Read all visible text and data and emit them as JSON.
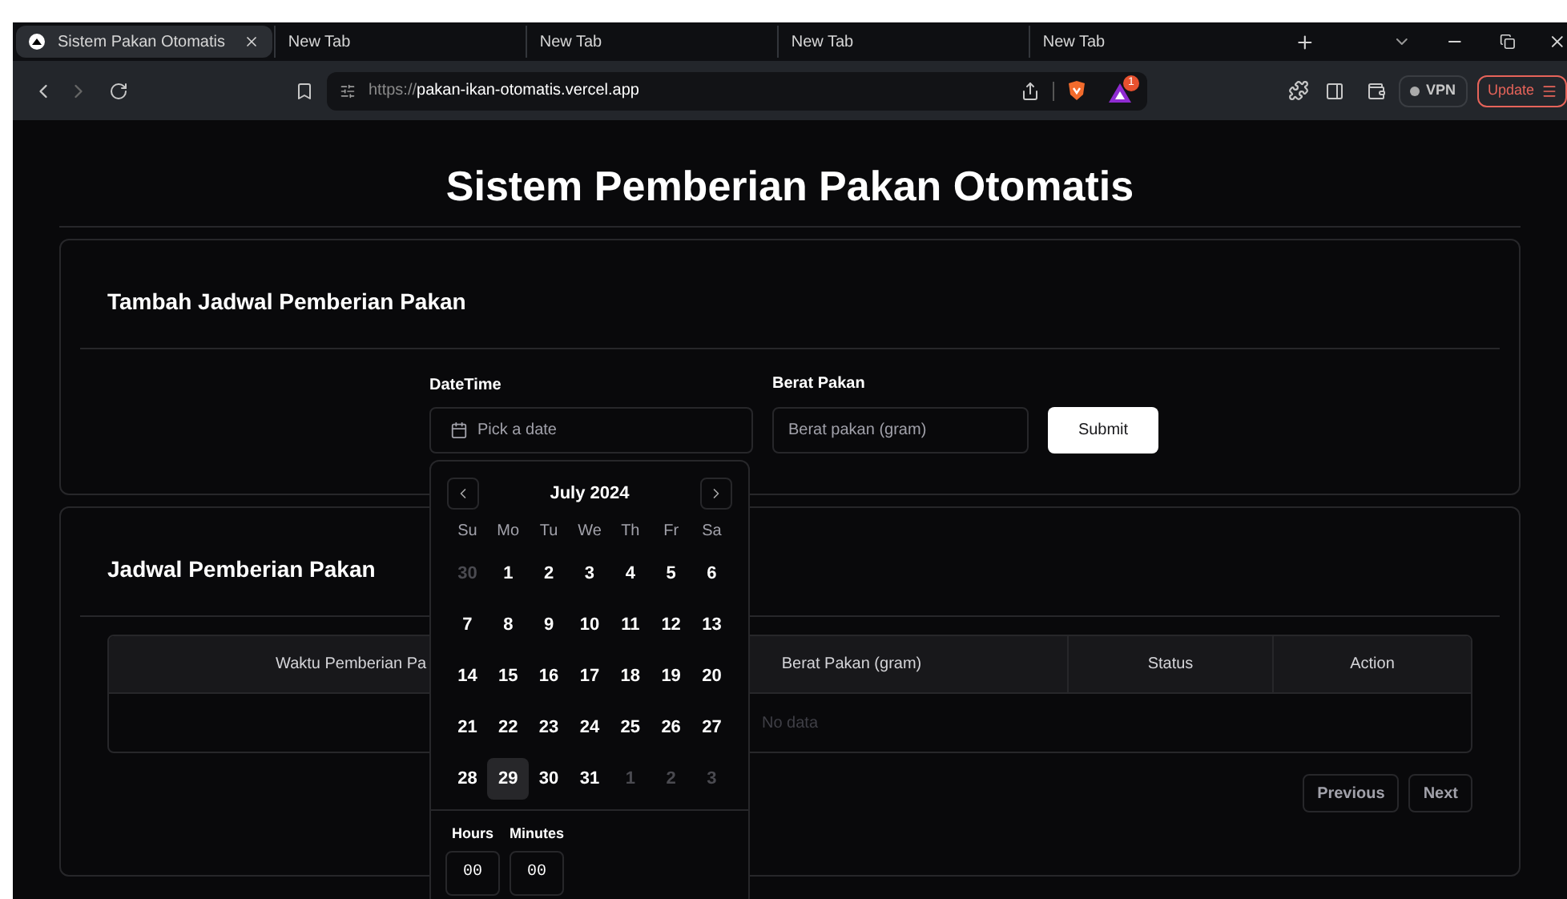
{
  "browser": {
    "tabs": [
      {
        "title": "Sistem Pakan Otomatis",
        "selected": true
      },
      {
        "title": "New Tab",
        "selected": false
      },
      {
        "title": "New Tab",
        "selected": false
      },
      {
        "title": "New Tab",
        "selected": false
      },
      {
        "title": "New Tab",
        "selected": false
      }
    ],
    "url_scheme": "https://",
    "url_host": "pakan-ikan-otomatis.vercel.app",
    "alert_badge": "1",
    "vpn": "VPN",
    "update": "Update"
  },
  "page_title": "Sistem Pemberian Pakan Otomatis",
  "form_card": {
    "title": "Tambah Jadwal Pemberian Pakan",
    "datetime_label": "DateTime",
    "datetime_placeholder": "Pick a date",
    "weight_label": "Berat Pakan",
    "weight_placeholder": "Berat pakan (gram)",
    "submit": "Submit"
  },
  "calendar": {
    "month": "July 2024",
    "weekdays": [
      "Su",
      "Mo",
      "Tu",
      "We",
      "Th",
      "Fr",
      "Sa"
    ],
    "weeks": [
      [
        {
          "label": "30",
          "outside": true,
          "selected": false
        },
        {
          "label": "1",
          "outside": false,
          "selected": false
        },
        {
          "label": "2",
          "outside": false,
          "selected": false
        },
        {
          "label": "3",
          "outside": false,
          "selected": false
        },
        {
          "label": "4",
          "outside": false,
          "selected": false
        },
        {
          "label": "5",
          "outside": false,
          "selected": false
        },
        {
          "label": "6",
          "outside": false,
          "selected": false
        }
      ],
      [
        {
          "label": "7",
          "outside": false,
          "selected": false
        },
        {
          "label": "8",
          "outside": false,
          "selected": false
        },
        {
          "label": "9",
          "outside": false,
          "selected": false
        },
        {
          "label": "10",
          "outside": false,
          "selected": false
        },
        {
          "label": "11",
          "outside": false,
          "selected": false
        },
        {
          "label": "12",
          "outside": false,
          "selected": false
        },
        {
          "label": "13",
          "outside": false,
          "selected": false
        }
      ],
      [
        {
          "label": "14",
          "outside": false,
          "selected": false
        },
        {
          "label": "15",
          "outside": false,
          "selected": false
        },
        {
          "label": "16",
          "outside": false,
          "selected": false
        },
        {
          "label": "17",
          "outside": false,
          "selected": false
        },
        {
          "label": "18",
          "outside": false,
          "selected": false
        },
        {
          "label": "19",
          "outside": false,
          "selected": false
        },
        {
          "label": "20",
          "outside": false,
          "selected": false
        }
      ],
      [
        {
          "label": "21",
          "outside": false,
          "selected": false
        },
        {
          "label": "22",
          "outside": false,
          "selected": false
        },
        {
          "label": "23",
          "outside": false,
          "selected": false
        },
        {
          "label": "24",
          "outside": false,
          "selected": false
        },
        {
          "label": "25",
          "outside": false,
          "selected": false
        },
        {
          "label": "26",
          "outside": false,
          "selected": false
        },
        {
          "label": "27",
          "outside": false,
          "selected": false
        }
      ],
      [
        {
          "label": "28",
          "outside": false,
          "selected": false
        },
        {
          "label": "29",
          "outside": false,
          "selected": true
        },
        {
          "label": "30",
          "outside": false,
          "selected": false
        },
        {
          "label": "31",
          "outside": false,
          "selected": false
        },
        {
          "label": "1",
          "outside": true,
          "selected": false
        },
        {
          "label": "2",
          "outside": true,
          "selected": false
        },
        {
          "label": "3",
          "outside": true,
          "selected": false
        }
      ]
    ],
    "hours_label": "Hours",
    "minutes_label": "Minutes",
    "hours": "00",
    "minutes": "00"
  },
  "schedule_card": {
    "title": "Jadwal Pemberian Pakan",
    "columns": [
      "Waktu Pemberian Pa",
      "Berat Pakan (gram)",
      "Status",
      "Action"
    ],
    "empty": "No data",
    "pagination": [
      "Previous",
      "Next"
    ]
  }
}
